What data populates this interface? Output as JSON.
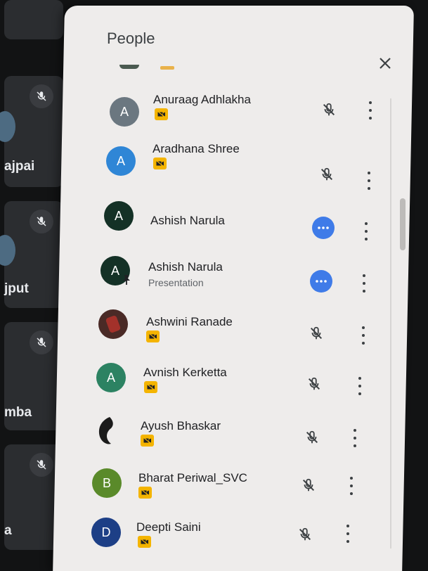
{
  "panel": {
    "title": "People"
  },
  "background_tiles": [
    {
      "name": "ajpai"
    },
    {
      "name": "jput"
    },
    {
      "name": "mba"
    },
    {
      "name": "a"
    }
  ],
  "participants": [
    {
      "name": "Anuraag Adhlakha",
      "subtitle": "",
      "initial": "A",
      "avatar_color": "#6b7780",
      "status": "muted"
    },
    {
      "name": "Aradhana Shree",
      "subtitle": "",
      "initial": "A",
      "avatar_color": "#2f86d6",
      "status": "muted"
    },
    {
      "name": "Ashish Narula",
      "subtitle": "",
      "initial": "A",
      "avatar_color": "#143126",
      "status": "more"
    },
    {
      "name": "Ashish Narula",
      "subtitle": "Presentation",
      "initial": "A",
      "avatar_color": "#143126",
      "status": "more"
    },
    {
      "name": "Ashwini Ranade",
      "subtitle": "",
      "initial": "",
      "avatar_color": "#4a2a26",
      "status": "muted"
    },
    {
      "name": "Avnish Kerketta",
      "subtitle": "",
      "initial": "A",
      "avatar_color": "#2c8262",
      "status": "muted"
    },
    {
      "name": "Ayush Bhaskar",
      "subtitle": "",
      "initial": "",
      "avatar_color": "#2a2a2a",
      "status": "muted"
    },
    {
      "name": "Bharat Periwal_SVC",
      "subtitle": "",
      "initial": "B",
      "avatar_color": "#5a8a2a",
      "status": "muted"
    },
    {
      "name": "Deepti Saini",
      "subtitle": "",
      "initial": "D",
      "avatar_color": "#1d3f86",
      "status": "muted"
    }
  ],
  "colors": {
    "badge": "#f4b400",
    "accent_blue": "#3f7be8",
    "panel_bg": "#eeeceb"
  }
}
